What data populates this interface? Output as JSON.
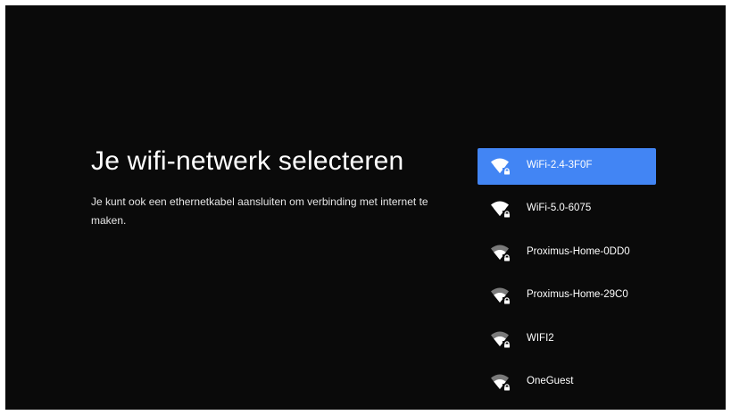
{
  "screen": {
    "title": "Je wifi-netwerk selecteren",
    "description": "Je kunt ook een ethernetkabel aansluiten om verbinding met internet te maken."
  },
  "colors": {
    "background": "#0a0a0a",
    "selected": "#4285f4",
    "signal_full": "#ffffff",
    "signal_dim": "#7a7a7a"
  },
  "networks": [
    {
      "name": "WiFi-2.4-3F0F",
      "selected": true,
      "signal_bars": 4,
      "secured": true,
      "icon": "wifi-lock-icon"
    },
    {
      "name": "WiFi-5.0-6075",
      "selected": false,
      "signal_bars": 4,
      "secured": true,
      "icon": "wifi-lock-icon"
    },
    {
      "name": "Proximus-Home-0DD0",
      "selected": false,
      "signal_bars": 3,
      "secured": true,
      "icon": "wifi-lock-icon"
    },
    {
      "name": "Proximus-Home-29C0",
      "selected": false,
      "signal_bars": 3,
      "secured": true,
      "icon": "wifi-lock-icon"
    },
    {
      "name": "WIFI2",
      "selected": false,
      "signal_bars": 3,
      "secured": true,
      "icon": "wifi-lock-icon"
    },
    {
      "name": "OneGuest",
      "selected": false,
      "signal_bars": 3,
      "secured": true,
      "icon": "wifi-lock-icon"
    }
  ]
}
